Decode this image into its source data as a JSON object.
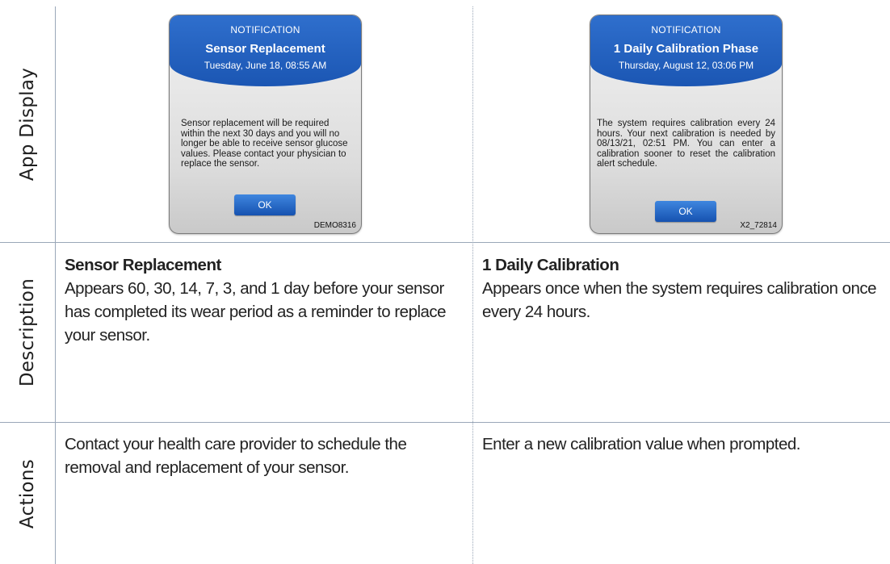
{
  "row_labels": {
    "app_display": "App Display",
    "description": "Description",
    "actions": "Actions"
  },
  "notifications": [
    {
      "kicker": "NOTIFICATION",
      "title": "Sensor Replacement",
      "date": "Tuesday, June 18, 08:55 AM",
      "message": "Sensor replacement will be required within the next 30 days and you will no longer be able to receive sensor glucose values. Please contact your physician to replace the sensor.",
      "button": "OK",
      "code": "DEMO8316"
    },
    {
      "kicker": "NOTIFICATION",
      "title": "1 Daily Calibration Phase",
      "date": "Thursday, August 12, 03:06 PM",
      "message": "The system requires calibration every 24 hours. Your next calibration is needed by 08/13/21, 02:51 PM. You can enter a calibration sooner to reset the calibration alert schedule.",
      "button": "OK",
      "code": "X2_72814"
    }
  ],
  "descriptions": [
    {
      "title": "Sensor Replacement",
      "text": "Appears 60, 30, 14, 7, 3, and 1 day before your sensor has completed its wear period as a reminder to replace your sensor."
    },
    {
      "title": "1 Daily Calibration",
      "text": "Appears once when the system requires calibration once every 24 hours."
    }
  ],
  "actions": [
    "Contact your health care provider to schedule the removal and replacement of your sensor.",
    "Enter a new calibration value when prompted."
  ]
}
